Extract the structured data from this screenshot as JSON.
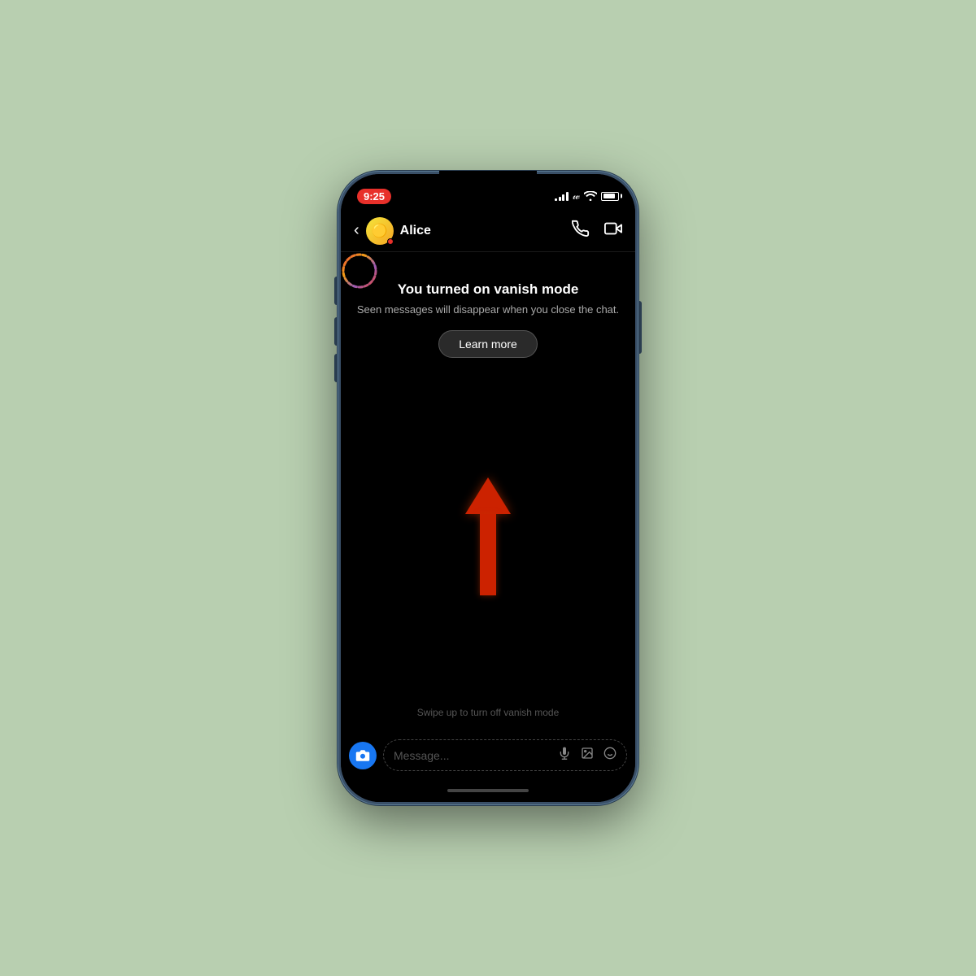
{
  "background_color": "#b8cfb0",
  "phone": {
    "status_bar": {
      "time": "9:25",
      "signal_bars": [
        3,
        6,
        9,
        11,
        13
      ],
      "wifi": "wifi",
      "battery": 85
    },
    "header": {
      "back_label": "‹",
      "contact_name": "Alice",
      "call_icon": "phone",
      "video_icon": "video"
    },
    "vanish_mode": {
      "icon_label": "vanish-ring",
      "title": "You turned on vanish mode",
      "subtitle": "Seen messages will disappear when you close the chat.",
      "learn_more": "Learn more"
    },
    "arrow": {
      "direction": "up",
      "swipe_hint": "Swipe up to turn off vanish mode"
    },
    "message_bar": {
      "placeholder": "Message...",
      "mic_icon": "mic",
      "gallery_icon": "image",
      "emoji_icon": "emoji"
    },
    "colors": {
      "background": "#000000",
      "header_bg": "#000000",
      "accent_blue": "#1877f2",
      "arrow_red": "#cc2200",
      "status_red": "#e8302a",
      "text_primary": "#ffffff",
      "text_secondary": "#aaaaaa",
      "text_muted": "#555555"
    }
  }
}
